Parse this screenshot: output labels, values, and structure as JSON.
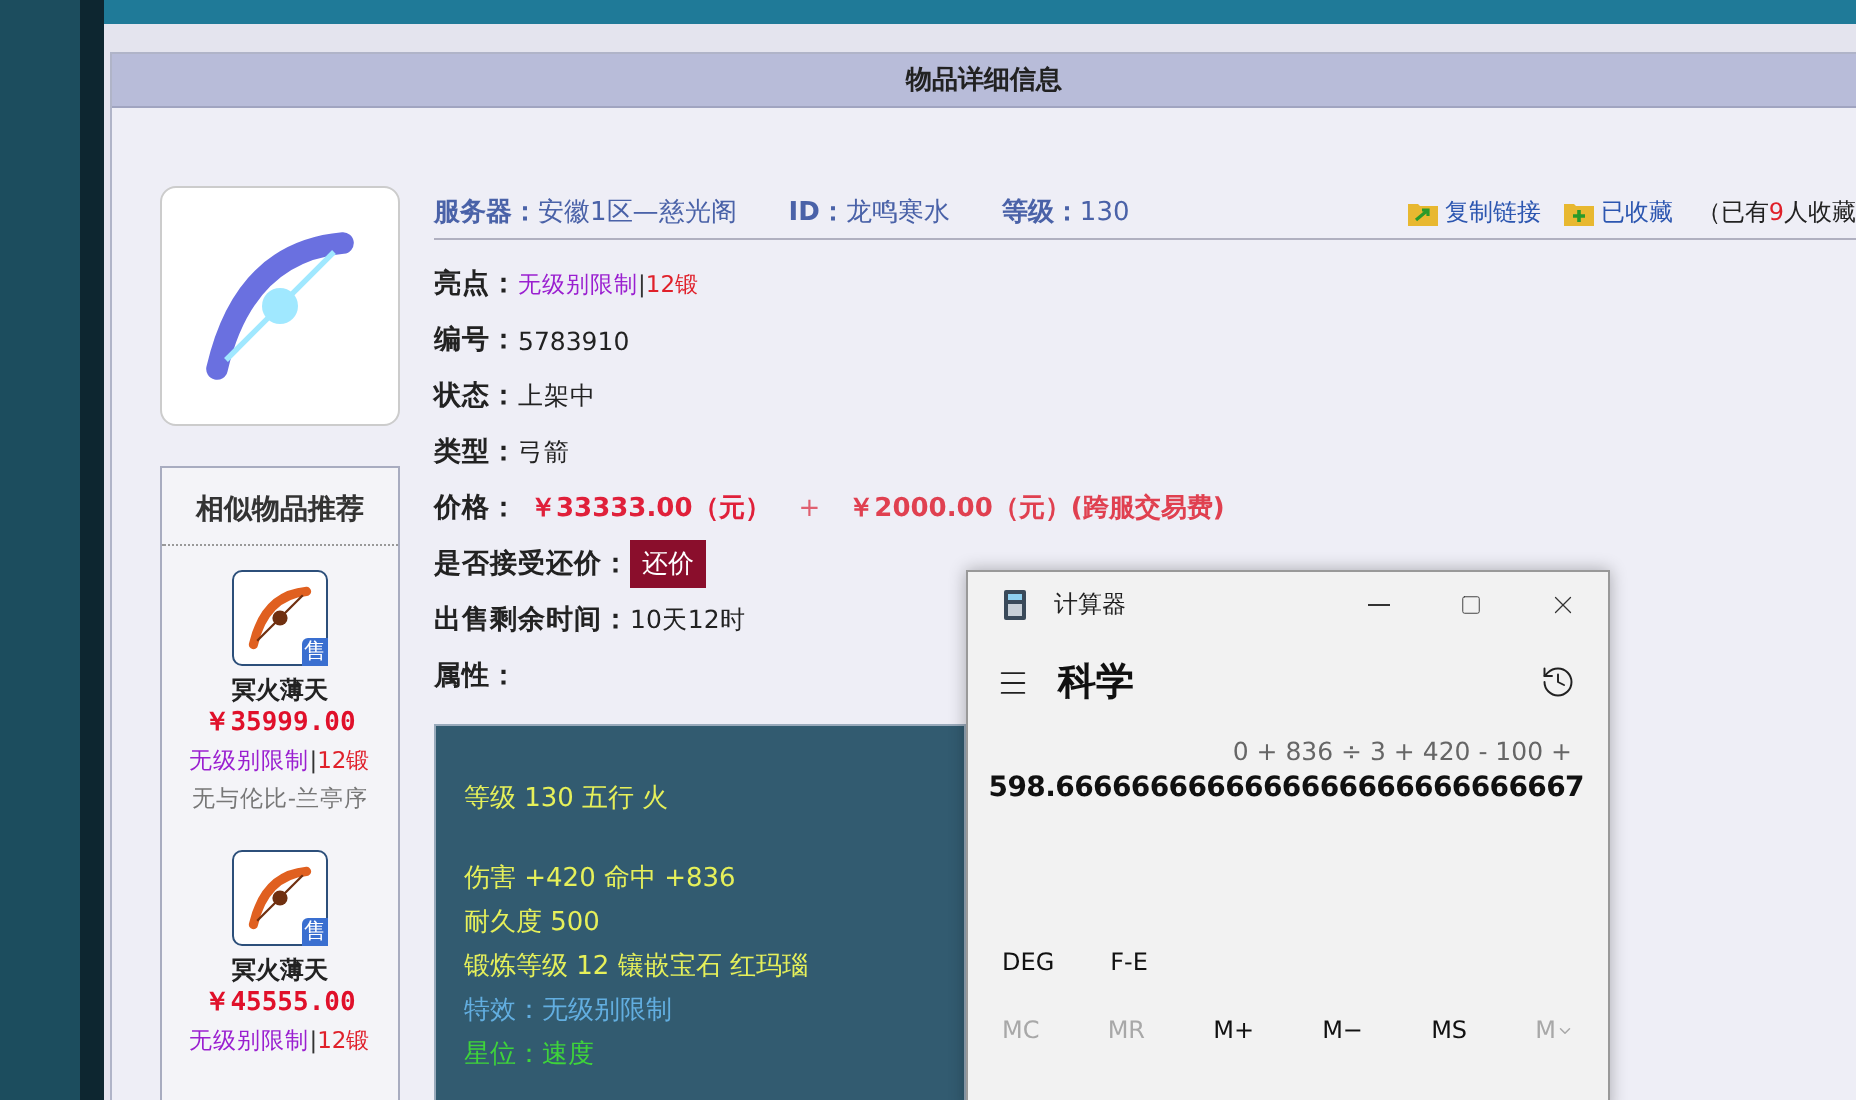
{
  "panel": {
    "title": "物品详细信息"
  },
  "summary": {
    "server_label": "服务器：",
    "server": "安徽1区—慈光阁",
    "id_label": "ID：",
    "id": "龙鸣寒水",
    "level_label": "等级：",
    "level_value": "130",
    "actions": [
      {
        "kind": "copy",
        "label": "复制链接"
      },
      {
        "kind": "favorite",
        "label": "已收藏"
      }
    ],
    "fav_prefix": "（已有",
    "fav_count": "9",
    "fav_suffix": "人收藏"
  },
  "fields": [
    {
      "kind": "tags",
      "label": "亮点：",
      "tag_a": "无级别限制",
      "sep": "|",
      "tag_b": "12锻"
    },
    {
      "kind": "text",
      "label": "编号：",
      "value": "5783910"
    },
    {
      "kind": "text",
      "label": "状态：",
      "value": "上架中"
    },
    {
      "kind": "text",
      "label": "类型：",
      "value": "弓箭"
    },
    {
      "kind": "price",
      "label": "价格：",
      "price": "￥33333.00（元）",
      "plus": "+",
      "fee": "￥2000.00（元）(跨服交易费)"
    },
    {
      "kind": "button",
      "label": "是否接受还价：",
      "button": "还价"
    },
    {
      "kind": "text",
      "label": "出售剩余时间：",
      "value": "10天12时"
    },
    {
      "kind": "text",
      "label": "属性："
    }
  ],
  "attribute_groups": [
    [
      {
        "text": "等级 130 五行 火",
        "color": "#e6f05a"
      }
    ],
    [
      {
        "text": "伤害 +420 命中 +836",
        "color": "#e6f05a"
      },
      {
        "text": "耐久度 500",
        "color": "#e6f05a"
      },
      {
        "text": "锻炼等级 12 镶嵌宝石 红玛瑙",
        "color": "#e6f05a"
      },
      {
        "text": "特效：无级别限制",
        "color": "#62aee0"
      },
      {
        "text": "星位：速度",
        "color": "#3ed43a"
      }
    ]
  ],
  "similar": {
    "title": "相似物品推荐",
    "items": [
      {
        "badge": "售",
        "name": "冥火薄天",
        "price": "￥35999.00",
        "tag_a": "无级别限制",
        "sep": "|",
        "tag_b": "12锻",
        "server": "无与伦比-兰亭序"
      },
      {
        "badge": "售",
        "name": "冥火薄天",
        "price": "￥45555.00",
        "tag_a": "无级别限制",
        "sep": "|",
        "tag_b": "12锻"
      }
    ]
  },
  "calculator": {
    "title": "计算器",
    "mode": "科学",
    "expression": "0 + 836 ÷ 3 + 420 - 100 +",
    "result": "598.6666666666666666666666666667",
    "toggles": [
      "DEG",
      "F-E"
    ],
    "memory": [
      {
        "label": "MC",
        "disabled": true
      },
      {
        "label": "MR",
        "disabled": true
      },
      {
        "label": "M+",
        "disabled": false
      },
      {
        "label": "M−",
        "disabled": false
      },
      {
        "label": "MS",
        "disabled": false
      },
      {
        "label": "M",
        "disabled": true,
        "kind": "dropdown"
      }
    ]
  }
}
